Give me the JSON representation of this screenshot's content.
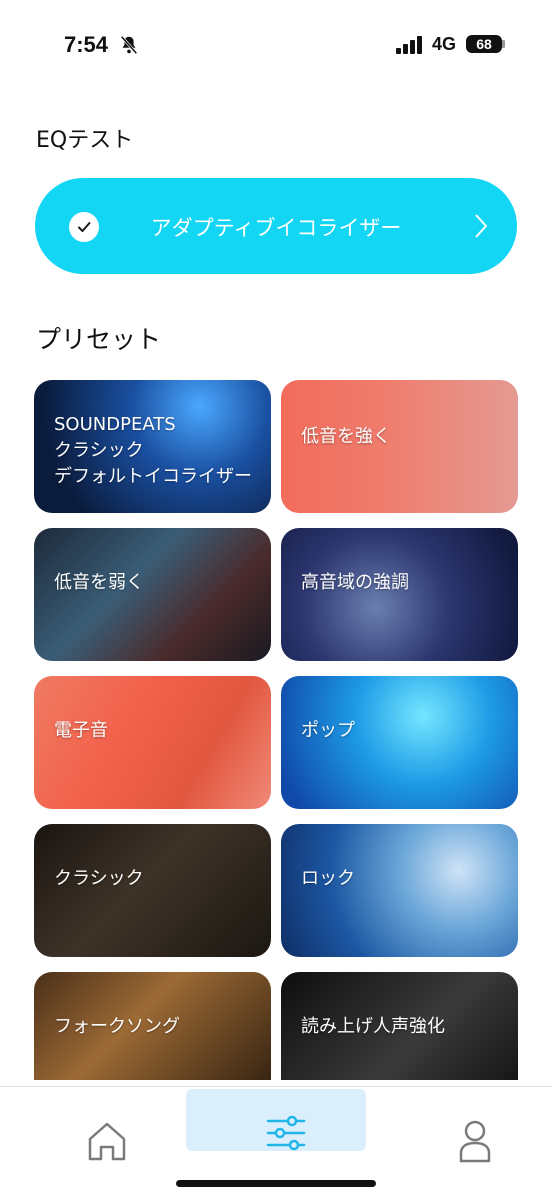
{
  "status_bar": {
    "time": "7:54",
    "network": "4G",
    "battery": "68"
  },
  "eq_test": {
    "section_title": "EQテスト",
    "button_label": "アダプティブイコライザー"
  },
  "presets": {
    "section_title": "プリセット",
    "items": [
      {
        "label": "SOUNDPEATS\nクラシック\nデフォルトイコライザー"
      },
      {
        "label": "低音を強く"
      },
      {
        "label": "低音を弱く"
      },
      {
        "label": "高音域の強調"
      },
      {
        "label": "電子音"
      },
      {
        "label": "ポップ"
      },
      {
        "label": "クラシック"
      },
      {
        "label": "ロック"
      },
      {
        "label": "フォークソング"
      },
      {
        "label": "読み上げ人声強化"
      }
    ]
  },
  "tabbar": {
    "icons": [
      "home-icon",
      "equalizer-icon",
      "profile-icon"
    ],
    "active_color": "#dbeefc",
    "accent": "#12d6f4"
  }
}
